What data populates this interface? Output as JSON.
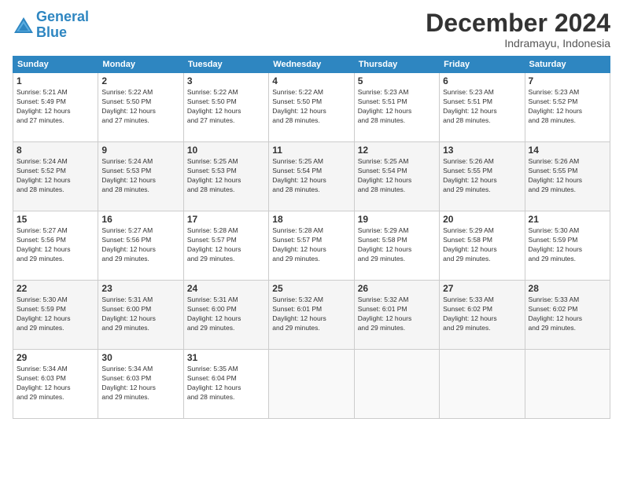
{
  "logo": {
    "line1": "General",
    "line2": "Blue"
  },
  "title": "December 2024",
  "subtitle": "Indramayu, Indonesia",
  "days_header": [
    "Sunday",
    "Monday",
    "Tuesday",
    "Wednesday",
    "Thursday",
    "Friday",
    "Saturday"
  ],
  "weeks": [
    [
      {
        "day": "1",
        "info": "Sunrise: 5:21 AM\nSunset: 5:49 PM\nDaylight: 12 hours\nand 27 minutes."
      },
      {
        "day": "2",
        "info": "Sunrise: 5:22 AM\nSunset: 5:50 PM\nDaylight: 12 hours\nand 27 minutes."
      },
      {
        "day": "3",
        "info": "Sunrise: 5:22 AM\nSunset: 5:50 PM\nDaylight: 12 hours\nand 27 minutes."
      },
      {
        "day": "4",
        "info": "Sunrise: 5:22 AM\nSunset: 5:50 PM\nDaylight: 12 hours\nand 28 minutes."
      },
      {
        "day": "5",
        "info": "Sunrise: 5:23 AM\nSunset: 5:51 PM\nDaylight: 12 hours\nand 28 minutes."
      },
      {
        "day": "6",
        "info": "Sunrise: 5:23 AM\nSunset: 5:51 PM\nDaylight: 12 hours\nand 28 minutes."
      },
      {
        "day": "7",
        "info": "Sunrise: 5:23 AM\nSunset: 5:52 PM\nDaylight: 12 hours\nand 28 minutes."
      }
    ],
    [
      {
        "day": "8",
        "info": "Sunrise: 5:24 AM\nSunset: 5:52 PM\nDaylight: 12 hours\nand 28 minutes."
      },
      {
        "day": "9",
        "info": "Sunrise: 5:24 AM\nSunset: 5:53 PM\nDaylight: 12 hours\nand 28 minutes."
      },
      {
        "day": "10",
        "info": "Sunrise: 5:25 AM\nSunset: 5:53 PM\nDaylight: 12 hours\nand 28 minutes."
      },
      {
        "day": "11",
        "info": "Sunrise: 5:25 AM\nSunset: 5:54 PM\nDaylight: 12 hours\nand 28 minutes."
      },
      {
        "day": "12",
        "info": "Sunrise: 5:25 AM\nSunset: 5:54 PM\nDaylight: 12 hours\nand 28 minutes."
      },
      {
        "day": "13",
        "info": "Sunrise: 5:26 AM\nSunset: 5:55 PM\nDaylight: 12 hours\nand 29 minutes."
      },
      {
        "day": "14",
        "info": "Sunrise: 5:26 AM\nSunset: 5:55 PM\nDaylight: 12 hours\nand 29 minutes."
      }
    ],
    [
      {
        "day": "15",
        "info": "Sunrise: 5:27 AM\nSunset: 5:56 PM\nDaylight: 12 hours\nand 29 minutes."
      },
      {
        "day": "16",
        "info": "Sunrise: 5:27 AM\nSunset: 5:56 PM\nDaylight: 12 hours\nand 29 minutes."
      },
      {
        "day": "17",
        "info": "Sunrise: 5:28 AM\nSunset: 5:57 PM\nDaylight: 12 hours\nand 29 minutes."
      },
      {
        "day": "18",
        "info": "Sunrise: 5:28 AM\nSunset: 5:57 PM\nDaylight: 12 hours\nand 29 minutes."
      },
      {
        "day": "19",
        "info": "Sunrise: 5:29 AM\nSunset: 5:58 PM\nDaylight: 12 hours\nand 29 minutes."
      },
      {
        "day": "20",
        "info": "Sunrise: 5:29 AM\nSunset: 5:58 PM\nDaylight: 12 hours\nand 29 minutes."
      },
      {
        "day": "21",
        "info": "Sunrise: 5:30 AM\nSunset: 5:59 PM\nDaylight: 12 hours\nand 29 minutes."
      }
    ],
    [
      {
        "day": "22",
        "info": "Sunrise: 5:30 AM\nSunset: 5:59 PM\nDaylight: 12 hours\nand 29 minutes."
      },
      {
        "day": "23",
        "info": "Sunrise: 5:31 AM\nSunset: 6:00 PM\nDaylight: 12 hours\nand 29 minutes."
      },
      {
        "day": "24",
        "info": "Sunrise: 5:31 AM\nSunset: 6:00 PM\nDaylight: 12 hours\nand 29 minutes."
      },
      {
        "day": "25",
        "info": "Sunrise: 5:32 AM\nSunset: 6:01 PM\nDaylight: 12 hours\nand 29 minutes."
      },
      {
        "day": "26",
        "info": "Sunrise: 5:32 AM\nSunset: 6:01 PM\nDaylight: 12 hours\nand 29 minutes."
      },
      {
        "day": "27",
        "info": "Sunrise: 5:33 AM\nSunset: 6:02 PM\nDaylight: 12 hours\nand 29 minutes."
      },
      {
        "day": "28",
        "info": "Sunrise: 5:33 AM\nSunset: 6:02 PM\nDaylight: 12 hours\nand 29 minutes."
      }
    ],
    [
      {
        "day": "29",
        "info": "Sunrise: 5:34 AM\nSunset: 6:03 PM\nDaylight: 12 hours\nand 29 minutes."
      },
      {
        "day": "30",
        "info": "Sunrise: 5:34 AM\nSunset: 6:03 PM\nDaylight: 12 hours\nand 29 minutes."
      },
      {
        "day": "31",
        "info": "Sunrise: 5:35 AM\nSunset: 6:04 PM\nDaylight: 12 hours\nand 28 minutes."
      },
      {
        "day": "",
        "info": ""
      },
      {
        "day": "",
        "info": ""
      },
      {
        "day": "",
        "info": ""
      },
      {
        "day": "",
        "info": ""
      }
    ]
  ]
}
